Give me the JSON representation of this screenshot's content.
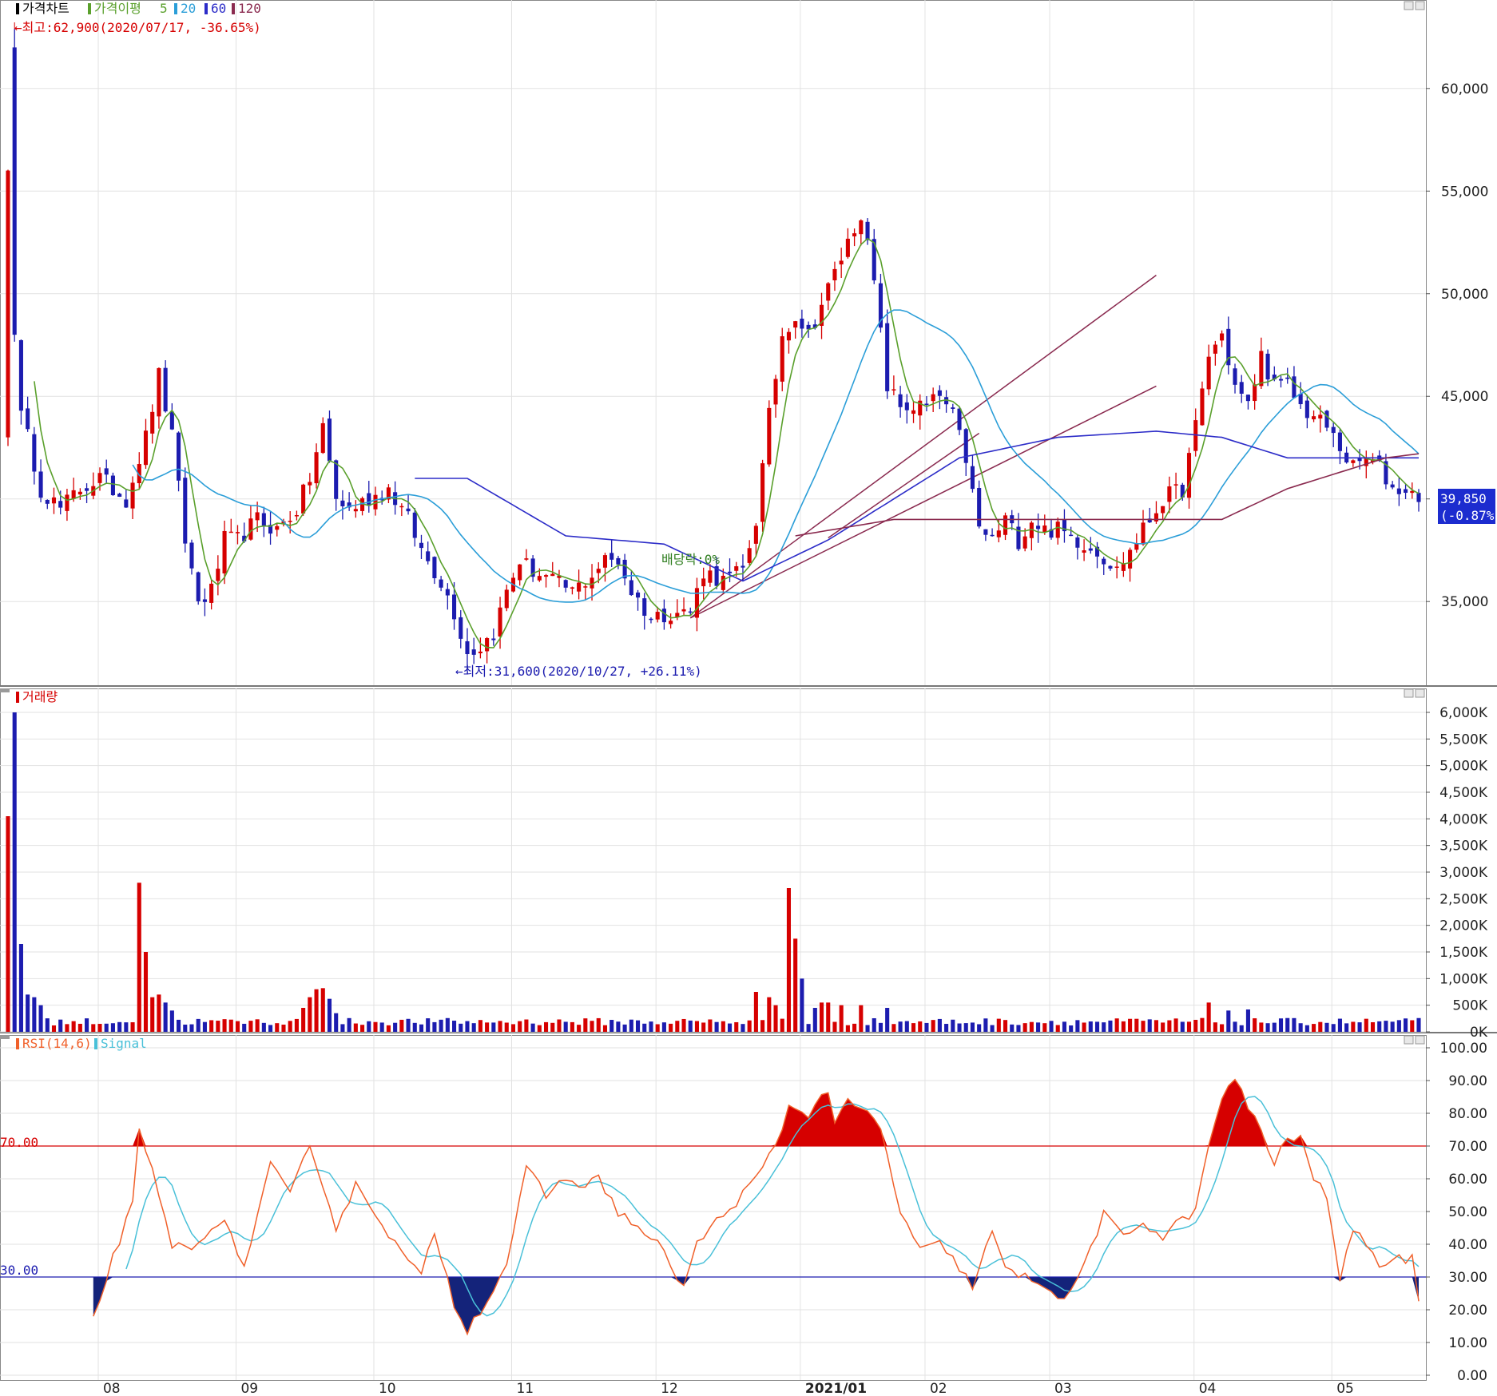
{
  "colors": {
    "up": "#d60000",
    "down": "#1c1caf",
    "ma5": "#5aa02c",
    "ma20": "#2b9ed8",
    "ma60": "#2c2cc8",
    "ma120": "#8a2a4f",
    "rsi": "#f0602a",
    "signal": "#49c0d8",
    "grid": "#e2e2e2",
    "trend": "#8a2a4f"
  },
  "x_axis": {
    "labels": [
      "08",
      "09",
      "10",
      "11",
      "12",
      "2021/01",
      "02",
      "03",
      "04",
      "05"
    ]
  },
  "panels": {
    "price": {
      "legend": {
        "price_label": "가격차트",
        "ma_label": "가격이평",
        "ma5": "5",
        "ma20": "20",
        "ma60": "60",
        "ma120": "120"
      },
      "y_ticks": [
        "60,000",
        "55,000",
        "50,000",
        "45,000",
        "35,000"
      ],
      "high_note": "←최고:62,900(2020/07/17, -36.65%)",
      "low_note": "←최저:31,600(2020/10/27, +26.11%)",
      "dividend_note": "배당락:0%",
      "last_price": "39,850",
      "last_change": "(-0.87%)"
    },
    "volume": {
      "legend": "거래량",
      "y_ticks": [
        "6,000K",
        "5,500K",
        "5,000K",
        "4,500K",
        "4,000K",
        "3,500K",
        "3,000K",
        "2,500K",
        "2,000K",
        "1,500K",
        "1,000K",
        "500K",
        "0K"
      ]
    },
    "rsi": {
      "legend_rsi": "RSI(14,6)",
      "legend_signal": "Signal",
      "y_ticks": [
        "100.00",
        "90.00",
        "80.00",
        "70.00",
        "60.00",
        "50.00",
        "40.00",
        "30.00",
        "20.00",
        "10.00",
        "0.00"
      ],
      "upper_label": "70.00",
      "lower_label": "30.00"
    }
  },
  "chart_data": [
    {
      "type": "candlestick",
      "y_range": [
        31000,
        64000
      ],
      "month_boundaries": [
        "08",
        "09",
        "10",
        "11",
        "12",
        "2021/01",
        "02",
        "03",
        "04",
        "05"
      ],
      "anchors": [
        {
          "date": "2020-07-16",
          "value": 56000
        },
        {
          "date": "2020-07-17",
          "high": 62900,
          "close": 48000
        },
        {
          "date": "2020-08",
          "value": 40000
        },
        {
          "date": "2020-08-mid",
          "value": 46000
        },
        {
          "date": "2020-08-late",
          "value": 35000
        },
        {
          "date": "2020-09",
          "value": 38000
        },
        {
          "date": "2020-09-mid",
          "value": 43500
        },
        {
          "date": "2020-10",
          "value": 40500
        },
        {
          "date": "2020-10-27",
          "low": 31600,
          "close": 32500
        },
        {
          "date": "2020-11",
          "value": 36000
        },
        {
          "date": "2020-11-mid",
          "value": 38000
        },
        {
          "date": "2020-12",
          "value": 35500
        },
        {
          "date": "2020-12-mid",
          "value": 34500
        },
        {
          "date": "2020-12-late",
          "value": 36000
        },
        {
          "date": "2021-01",
          "value": 44000
        },
        {
          "date": "2021-01-mid",
          "value": 49000
        },
        {
          "date": "2021-01-late",
          "value": 53500
        },
        {
          "date": "2021-02",
          "value": 44500
        },
        {
          "date": "2021-02-mid",
          "value": 45000
        },
        {
          "date": "2021-03",
          "value": 37500
        },
        {
          "date": "2021-03-mid",
          "value": 38500
        },
        {
          "date": "2021-04",
          "value": 37000
        },
        {
          "date": "2021-04-mid",
          "value": 48000
        },
        {
          "date": "2021-05",
          "value": 45000
        },
        {
          "date": "2021-05-mid",
          "value": 42000
        },
        {
          "date": "2021-05-end",
          "value": 39850
        }
      ],
      "last_close": 39850,
      "last_change_pct": -0.87
    },
    {
      "type": "bar",
      "name": "거래량",
      "y_range": [
        0,
        6000
      ],
      "unit": "K",
      "spikes": [
        {
          "date": "2020-07-16",
          "value": 4050
        },
        {
          "date": "2020-07-17",
          "value": 6000
        },
        {
          "date": "2020-07-20",
          "value": 1650
        },
        {
          "date": "2020-08-14",
          "value": 2800
        },
        {
          "date": "2020-08-18",
          "value": 1500
        },
        {
          "date": "2021-01-07",
          "value": 2700
        },
        {
          "date": "2021-01-08",
          "value": 1750
        },
        {
          "date": "2021-01-11",
          "value": 1000
        }
      ],
      "baseline": 120
    },
    {
      "type": "line",
      "name": "RSI(14,6)",
      "y_range": [
        0,
        100
      ],
      "bands": [
        30,
        70
      ],
      "series": [
        {
          "name": "RSI(14,6)"
        },
        {
          "name": "Signal"
        }
      ],
      "anchors": [
        {
          "date": "2020-08-03",
          "rsi": 17
        },
        {
          "date": "2020-08-14",
          "rsi": 74
        },
        {
          "date": "2020-09",
          "rsi": 33
        },
        {
          "date": "2020-09-mid",
          "rsi": 70
        },
        {
          "date": "2020-10-27",
          "rsi": 14
        },
        {
          "date": "2020-11-20",
          "rsi": 63
        },
        {
          "date": "2020-12-24",
          "rsi": 27
        },
        {
          "date": "2021-01-mid",
          "rsi": 87
        },
        {
          "date": "2021-02",
          "rsi": 44
        },
        {
          "date": "2021-03",
          "rsi": 22
        },
        {
          "date": "2021-04-14",
          "rsi": 90
        },
        {
          "date": "2021-05",
          "rsi": 30
        },
        {
          "date": "2021-05-end",
          "rsi": 22
        }
      ]
    }
  ]
}
